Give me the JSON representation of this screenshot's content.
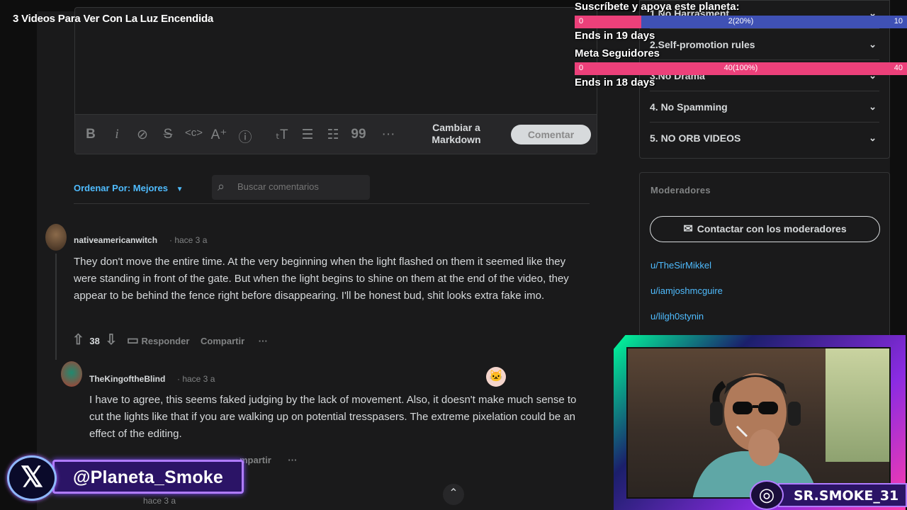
{
  "video_title": "3 Videos Para Ver Con La Luz Encendida",
  "editor": {
    "toolbar_icons": [
      "bold-icon",
      "italic-icon",
      "link-icon",
      "strikethrough-icon",
      "inline-code-icon",
      "superscript-icon",
      "spoiler-icon",
      "heading-icon",
      "bulleted-list-icon",
      "numbered-list-icon",
      "quote-icon",
      "more-icon"
    ],
    "markdown_toggle": "Cambiar a Markdown",
    "comment_button": "Comentar"
  },
  "sort": {
    "label": "Ordenar Por: Mejores"
  },
  "search": {
    "placeholder": "Buscar comentarios"
  },
  "comments": [
    {
      "username": "nativeamericanwitch",
      "time": "· hace 3 a",
      "body": "They don't move the entire time. At the very beginning when the light flashed on them it seemed like they were standing in front of the gate. But when the light begins to shine on them at the end of the video, they appear to be behind the fence right before disappearing. I'll be honest bud, shit looks extra fake imo.",
      "votes": "38",
      "reply": "Responder",
      "share": "Compartir",
      "more": "···"
    },
    {
      "username": "TheKingoftheBlind",
      "time": "· hace 3 a",
      "body": "I have to agree, this seems faked judging by the lack of movement. Also, it doesn't make much sense to cut the lights like that if you are walking up on potential tresspasers. The extreme pixelation could be an effect of the editing.",
      "share": "mpartir",
      "more": "···"
    }
  ],
  "next_comment_meta": "hace 3 a",
  "rules": [
    {
      "label": "1.No Harrasment"
    },
    {
      "label": "2.Self-promotion rules"
    },
    {
      "label": "3.No Drama"
    },
    {
      "label": "4. No Spamming"
    },
    {
      "label": "5. NO ORB VIDEOS"
    }
  ],
  "moderators": {
    "title": "Moderadores",
    "contact_button": "Contactar con los moderadores",
    "users": [
      "u/TheSirMikkel",
      "u/iamjoshmcguire",
      "u/lilgh0stynin"
    ]
  },
  "goals": [
    {
      "title": "Suscríbete y apoya este planeta:",
      "min": "0",
      "current": "2(20%)",
      "max": "10",
      "fraction": 0.2,
      "ends": "Ends in 19 days"
    },
    {
      "title": "Meta Seguidores",
      "min": "0",
      "current": "40(100%)",
      "max": "40",
      "fraction": 1.0,
      "ends": "Ends in 18 days"
    }
  ],
  "social": {
    "twitter_handle": "@Planeta_Smoke",
    "instagram_handle": "SR.SMOKE_31"
  },
  "colors": {
    "accent_blue": "#4fbcff",
    "goal_pink": "#ec407a",
    "goal_blue": "#3f51b5"
  }
}
